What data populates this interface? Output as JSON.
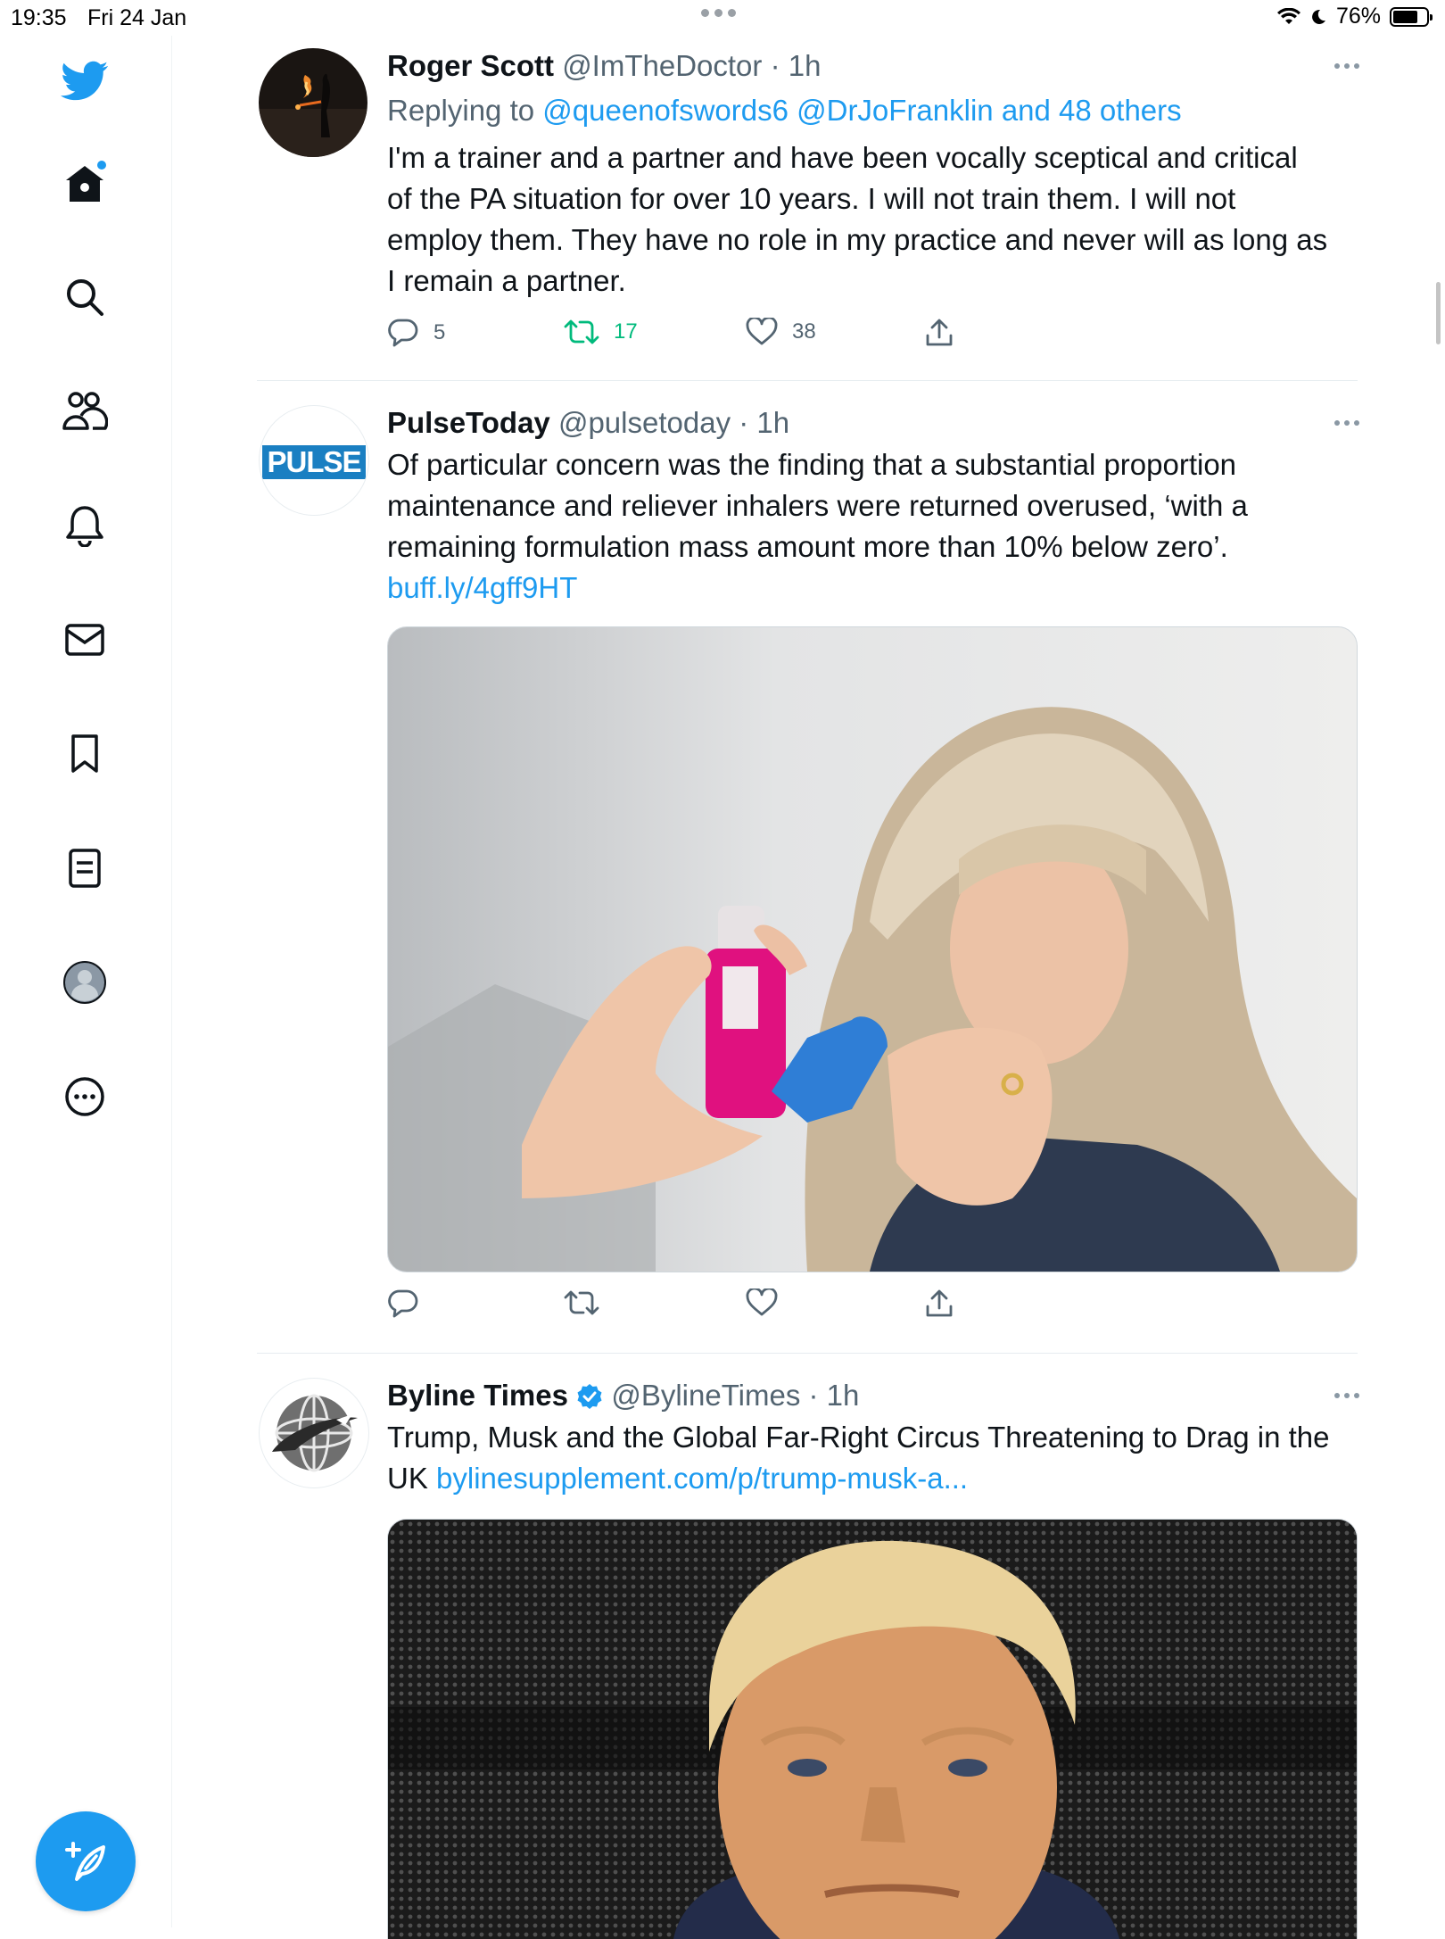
{
  "status_bar": {
    "time": "19:35",
    "date": "Fri 24 Jan",
    "battery": "76%",
    "battery_level": 0.76
  },
  "sidebar": {
    "items": [
      {
        "icon": "twitter-bird-icon"
      },
      {
        "icon": "home-icon"
      },
      {
        "icon": "search-icon"
      },
      {
        "icon": "communities-icon"
      },
      {
        "icon": "notifications-bell-icon"
      },
      {
        "icon": "messages-envelope-icon"
      },
      {
        "icon": "bookmarks-icon"
      },
      {
        "icon": "lists-icon"
      },
      {
        "icon": "profile-avatar-icon"
      },
      {
        "icon": "more-options-icon"
      }
    ],
    "compose_icon": "compose-tweet-icon"
  },
  "tweets": [
    {
      "name": "Roger Scott",
      "handle": "@ImTheDoctor",
      "time": "1h",
      "reply_prefix": "Replying to",
      "reply_to": "@queenofswords6 @DrJoFranklin and 48 others",
      "text_lines": [
        "I'm a trainer and a partner and have been vocally sceptical and critical",
        "of the PA situation for over 10 years.  I will not train them. I will not",
        "employ them. They have no role in my practice and never will as long as",
        "I remain a partner."
      ],
      "replies": "5",
      "retweets": "17",
      "likes": "38"
    },
    {
      "name": "PulseToday",
      "handle": "@pulsetoday",
      "time": "1h",
      "avatar_text": "PULSE",
      "text_lines": [
        "Of particular concern was the finding that a substantial proportion",
        "maintenance and reliever inhalers were returned overused, ‘with a",
        "remaining formulation mass amount more than 10% below zero’."
      ],
      "link": "buff.ly/4gff9HT"
    },
    {
      "name": "Byline Times",
      "handle": "@BylineTimes",
      "time": "1h",
      "verified": true,
      "text_line1": "Trump, Musk and the Global Far-Right Circus Threatening to Drag in the",
      "text_line2_prefix": "UK",
      "link": "bylinesupplement.com/p/trump-musk-a..."
    }
  ],
  "colors": {
    "accent": "#1d9bf0",
    "retweet_green": "#00ba7c",
    "muted": "#536471",
    "text": "#0f1419"
  }
}
